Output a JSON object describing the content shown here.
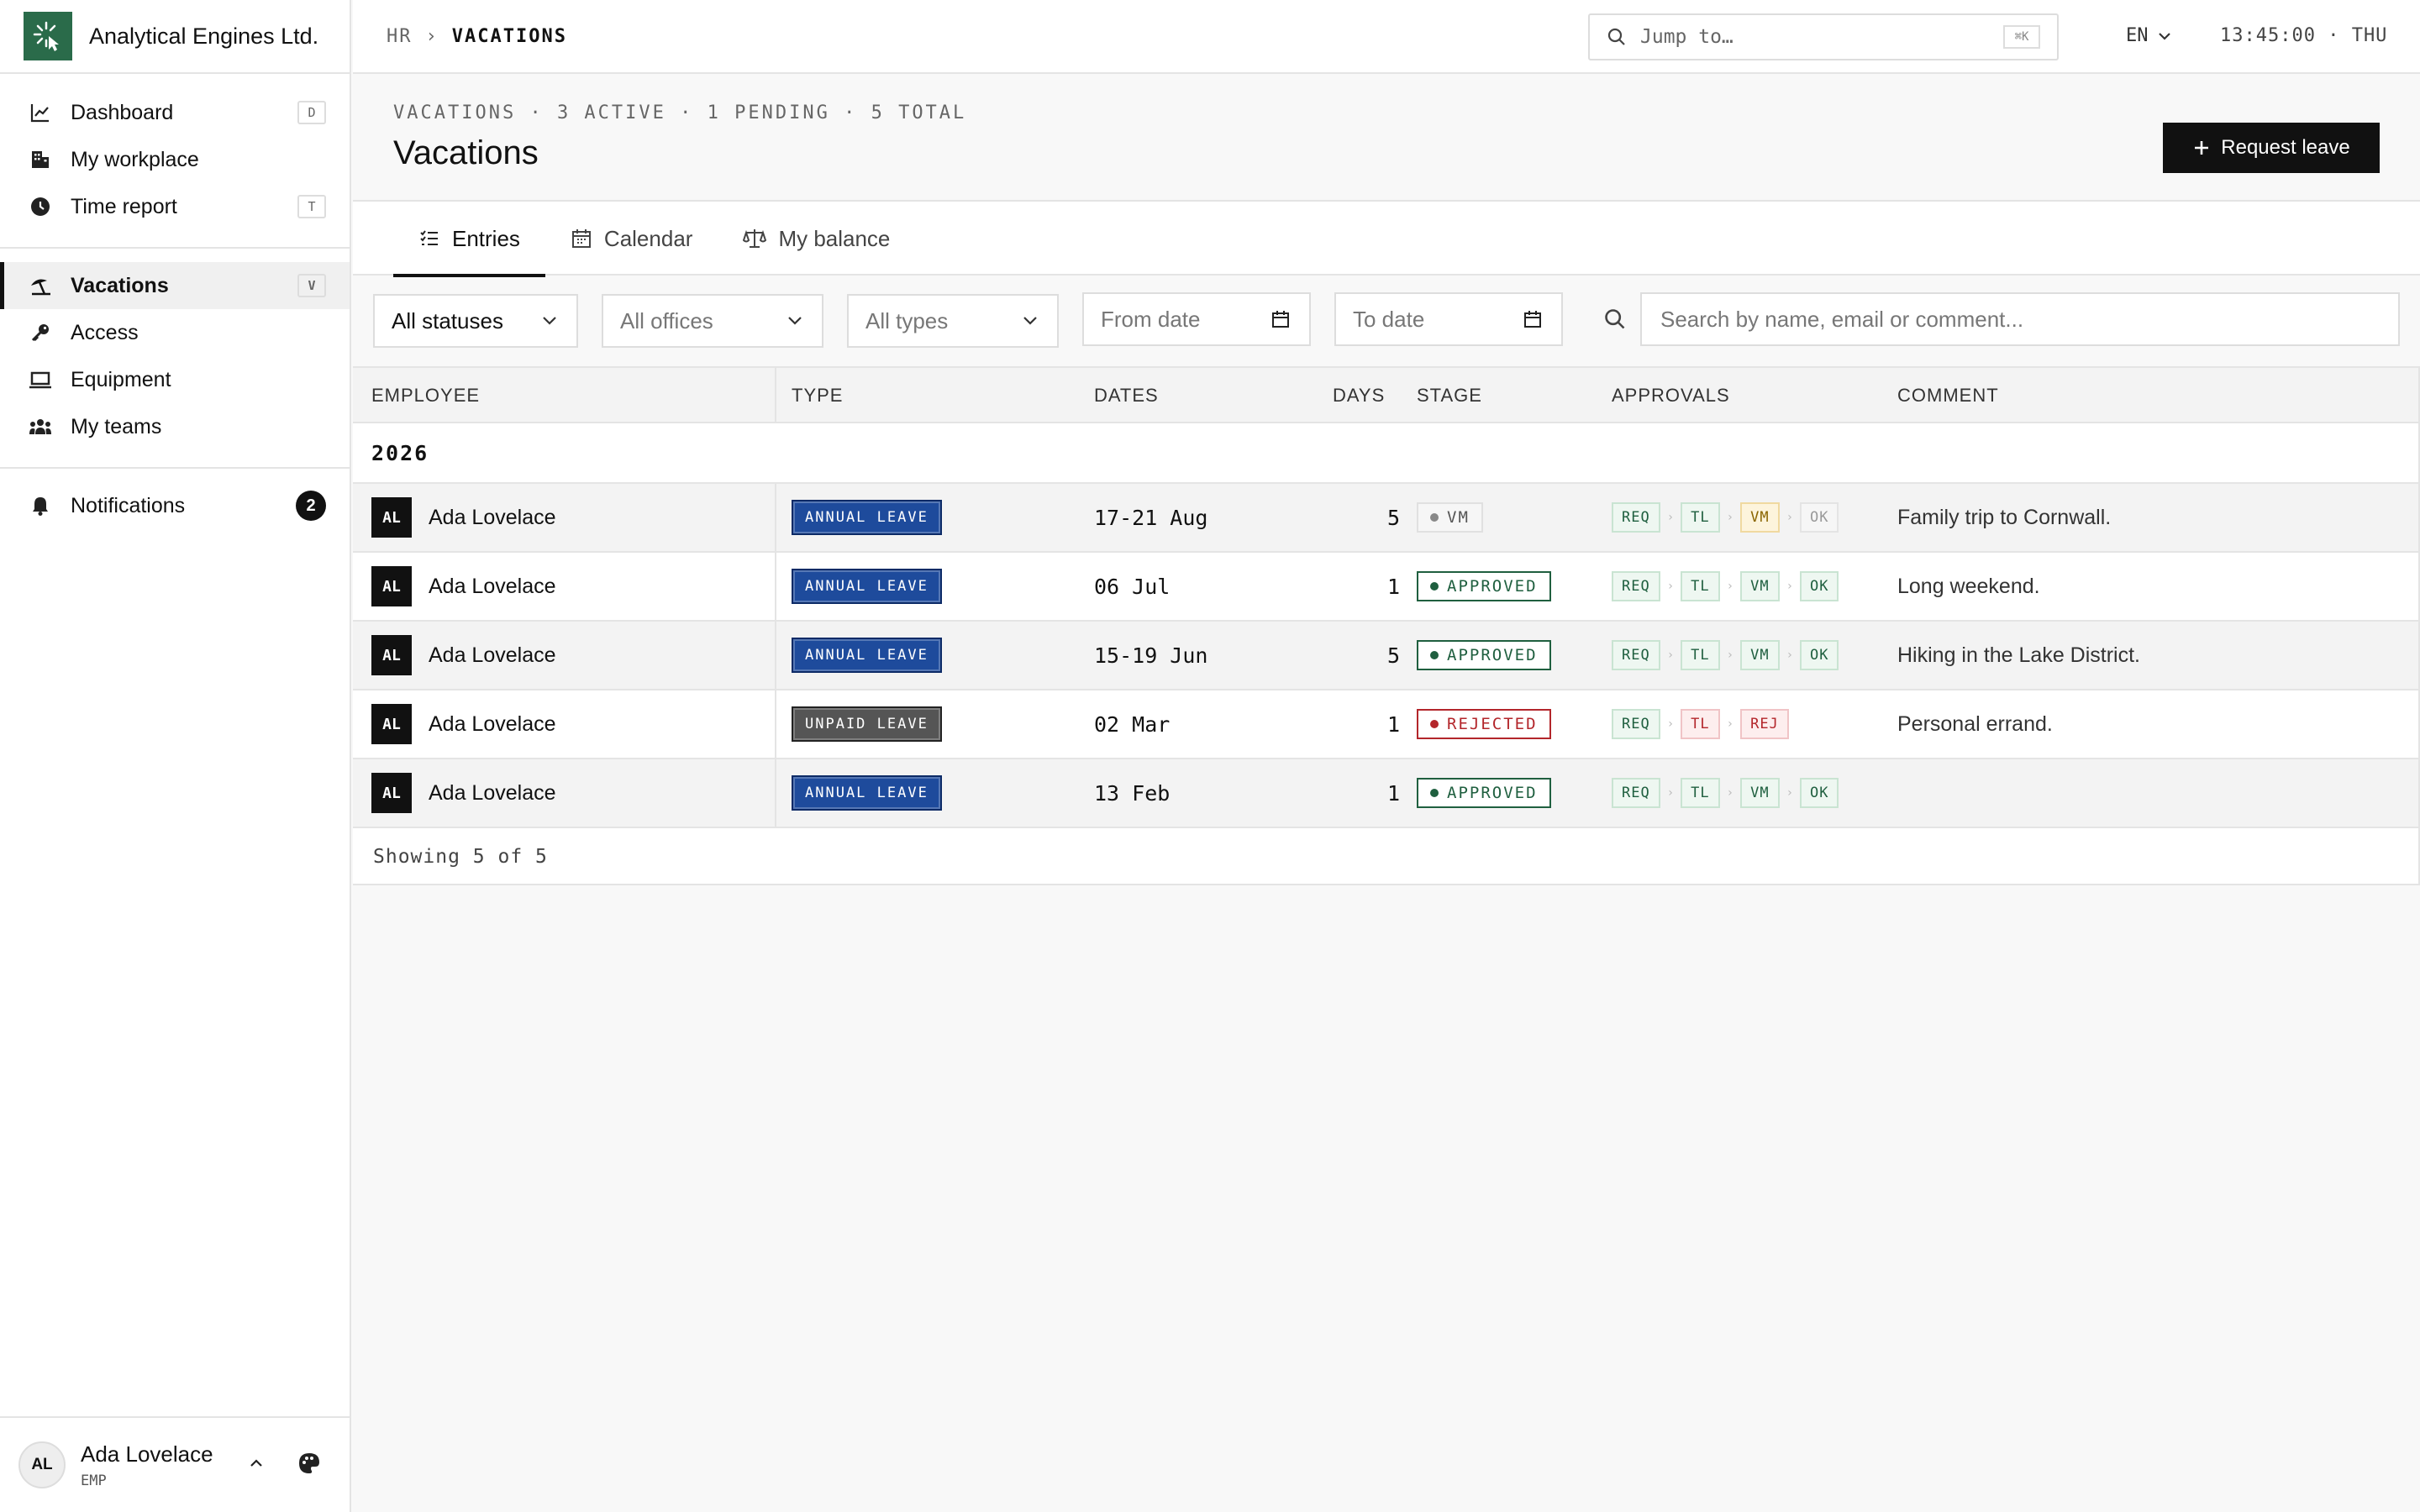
{
  "brand": {
    "name": "Analytical Engines Ltd."
  },
  "sidebar": {
    "items": [
      {
        "label": "Dashboard",
        "icon": "chart-line-icon",
        "kbd": "D"
      },
      {
        "label": "My workplace",
        "icon": "building-icon",
        "kbd": ""
      },
      {
        "label": "Time report",
        "icon": "clock-icon",
        "kbd": "T"
      },
      {
        "label": "Vacations",
        "icon": "beach-umbrella-icon",
        "kbd": "V",
        "active": true
      },
      {
        "label": "Access",
        "icon": "key-icon",
        "kbd": ""
      },
      {
        "label": "Equipment",
        "icon": "laptop-icon",
        "kbd": ""
      },
      {
        "label": "My teams",
        "icon": "users-icon",
        "kbd": ""
      }
    ],
    "notifications": {
      "label": "Notifications",
      "count": "2"
    }
  },
  "user": {
    "initials": "AL",
    "name": "Ada Lovelace",
    "role": "EMP"
  },
  "topbar": {
    "breadcrumb_root": "HR",
    "breadcrumb_sep": "›",
    "breadcrumb_current": "VACATIONS",
    "jump_placeholder": "Jump to…",
    "jump_shortcut": "⌘K",
    "language": "EN",
    "clock": "13:45:00 · THU"
  },
  "page": {
    "meta": "VACATIONS · 3 ACTIVE · 1 PENDING · 5 TOTAL",
    "title": "Vacations",
    "request_button": "Request leave"
  },
  "tabs": [
    {
      "label": "Entries",
      "icon": "list-check-icon",
      "active": true
    },
    {
      "label": "Calendar",
      "icon": "calendar-icon"
    },
    {
      "label": "My balance",
      "icon": "scale-icon"
    }
  ],
  "filters": {
    "status": "All statuses",
    "offices": "All offices",
    "types": "All types",
    "from_date": "From date",
    "to_date": "To date",
    "search_placeholder": "Search by name, email or comment..."
  },
  "table": {
    "columns": [
      "EMPLOYEE",
      "TYPE",
      "DATES",
      "DAYS",
      "STAGE",
      "APPROVALS",
      "COMMENT"
    ],
    "group": "2026",
    "rows": [
      {
        "initials": "AL",
        "name": "Ada Lovelace",
        "type": "ANNUAL LEAVE",
        "dates": "17-21 Aug",
        "days": "5",
        "stage": "VM",
        "comment": "Family trip to Cornwall."
      },
      {
        "initials": "AL",
        "name": "Ada Lovelace",
        "type": "ANNUAL LEAVE",
        "dates": "06 Jul",
        "days": "1",
        "stage": "APPROVED",
        "comment": "Long weekend."
      },
      {
        "initials": "AL",
        "name": "Ada Lovelace",
        "type": "ANNUAL LEAVE",
        "dates": "15-19 Jun",
        "days": "5",
        "stage": "APPROVED",
        "comment": "Hiking in the Lake District."
      },
      {
        "initials": "AL",
        "name": "Ada Lovelace",
        "type": "UNPAID LEAVE",
        "dates": "02 Mar",
        "days": "1",
        "stage": "REJECTED",
        "comment": "Personal errand."
      },
      {
        "initials": "AL",
        "name": "Ada Lovelace",
        "type": "ANNUAL LEAVE",
        "dates": "13 Feb",
        "days": "1",
        "stage": "APPROVED",
        "comment": ""
      }
    ],
    "approvals": {
      "req": "REQ",
      "tl": "TL",
      "vm": "VM",
      "ok": "OK",
      "rej": "REJ",
      "sep": "›"
    },
    "footer": "Showing 5 of 5"
  },
  "colors": {
    "brand_green": "#2a6b4a",
    "annual_blue": "#1e4b9c",
    "unpaid_gray": "#555555",
    "approved_green": "#1f5f3f",
    "rejected_red": "#b3262b",
    "pending_amber": "#b38600"
  }
}
